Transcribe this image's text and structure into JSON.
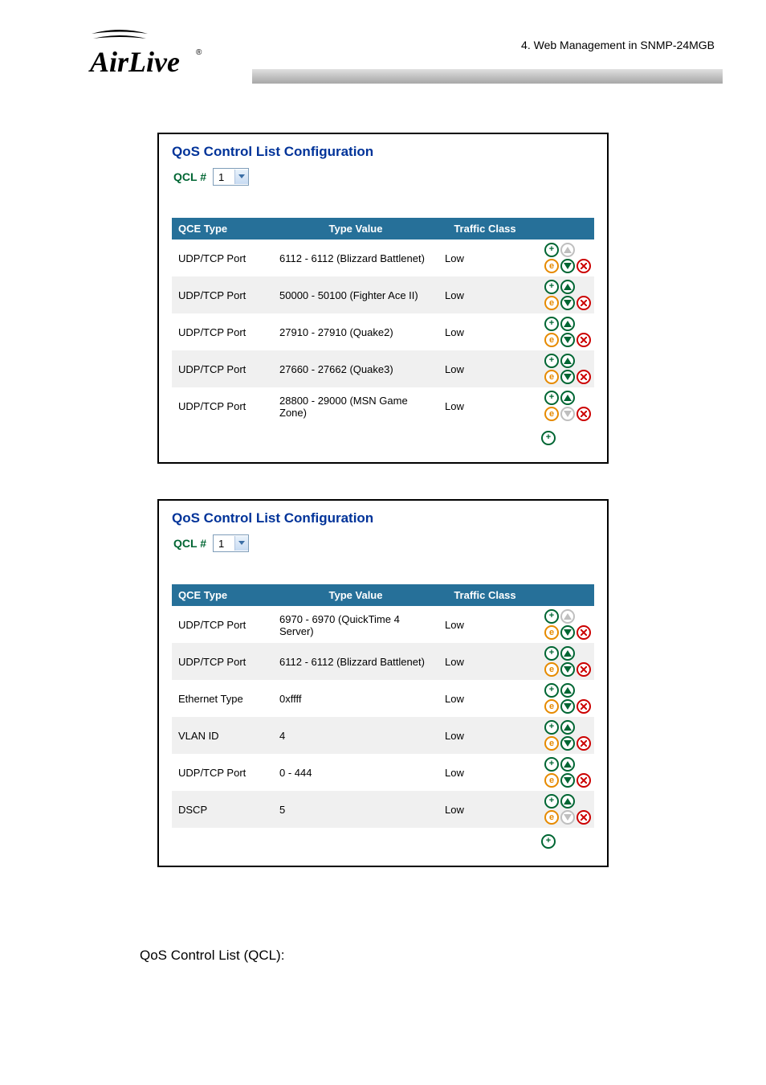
{
  "header": {
    "section_label": "4.  Web Management in SNMP-24MGB",
    "logo_alt": "AirLive"
  },
  "panel_title": "QoS Control List Configuration",
  "qcl_label": "QCL #",
  "qcl_value": "1",
  "columns": {
    "c1": "QCE Type",
    "c2": "Type Value",
    "c3": "Traffic Class"
  },
  "table1": {
    "rows": [
      {
        "type": "UDP/TCP Port",
        "value": "6112 - 6112 (Blizzard Battlenet)",
        "tc": "Low",
        "firstUpDisabled": true,
        "lastDownDisabled": false
      },
      {
        "type": "UDP/TCP Port",
        "value": "50000 - 50100 (Fighter Ace II)",
        "tc": "Low"
      },
      {
        "type": "UDP/TCP Port",
        "value": "27910 - 27910 (Quake2)",
        "tc": "Low"
      },
      {
        "type": "UDP/TCP Port",
        "value": "27660 - 27662 (Quake3)",
        "tc": "Low"
      },
      {
        "type": "UDP/TCP Port",
        "value": "28800 - 29000 (MSN Game Zone)",
        "tc": "Low",
        "lastDownDisabled": true
      }
    ]
  },
  "table2": {
    "rows": [
      {
        "type": "UDP/TCP Port",
        "value": "6970 - 6970 (QuickTime 4 Server)",
        "tc": "Low",
        "firstUpDisabled": true
      },
      {
        "type": "UDP/TCP Port",
        "value": "6112 - 6112 (Blizzard Battlenet)",
        "tc": "Low"
      },
      {
        "type": "Ethernet Type",
        "value": "0xffff",
        "tc": "Low"
      },
      {
        "type": "VLAN ID",
        "value": "4",
        "tc": "Low"
      },
      {
        "type": "UDP/TCP Port",
        "value": "0 - 444",
        "tc": "Low"
      },
      {
        "type": "DSCP",
        "value": "5",
        "tc": "Low",
        "lastDownDisabled": true
      }
    ]
  },
  "body_text": "QoS Control List (QCL):",
  "icons": {
    "add": "add-icon",
    "up": "arrow-up-icon",
    "down": "arrow-down-icon",
    "edit": "edit-icon",
    "delete": "delete-icon"
  }
}
